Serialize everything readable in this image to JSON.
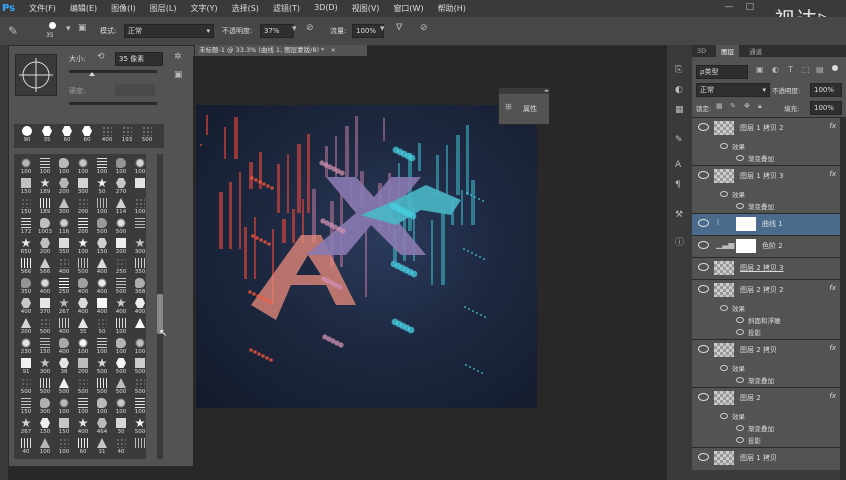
{
  "app": {
    "logo": "Ps",
    "watermark": "视达▷"
  },
  "menu": [
    "文件(F)",
    "编辑(E)",
    "图像(I)",
    "图层(L)",
    "文字(Y)",
    "选择(S)",
    "滤镜(T)",
    "3D(D)",
    "视图(V)",
    "窗口(W)",
    "帮助(H)"
  ],
  "window_controls": [
    "—",
    "□"
  ],
  "options_bar": {
    "brush_size": "35",
    "mode_label": "模式:",
    "mode_value": "正常",
    "opacity_label": "不透明度:",
    "opacity_value": "37%",
    "flow_label": "流量:",
    "flow_value": "100%"
  },
  "brush_panel": {
    "size_label": "大小:",
    "size_value": "35 像素",
    "hardness_label": "硬度:",
    "top_row": [
      "90",
      "35",
      "60",
      "60",
      "400",
      "193",
      "500"
    ],
    "grid_numbers": [
      [
        "100",
        "100",
        "100",
        "100",
        "100",
        "100",
        "100"
      ],
      [
        "150",
        "189",
        "200",
        "300",
        "50",
        "270",
        ""
      ],
      [
        "150",
        "189",
        "300",
        "200",
        "100",
        "114",
        "100"
      ],
      [
        "172",
        "1003",
        "116",
        "200",
        "500",
        "500",
        ""
      ],
      [
        "650",
        "200",
        "350",
        "100",
        "150",
        "200",
        "300"
      ],
      [
        "566",
        "566",
        "400",
        "500",
        "400",
        "250",
        "350"
      ],
      [
        "350",
        "400",
        "250",
        "400",
        "400",
        "500",
        "368"
      ],
      [
        "400",
        "370",
        "267",
        "400",
        "400",
        "400",
        "400"
      ],
      [
        "200",
        "500",
        "400",
        "35",
        "50",
        "100",
        ""
      ],
      [
        "230",
        "150",
        "400",
        "100",
        "100",
        "100",
        "100"
      ],
      [
        "91",
        "300",
        "38",
        "200",
        "500",
        "500",
        "500"
      ],
      [
        "500",
        "500",
        "500",
        "500",
        "500",
        "500",
        "500"
      ],
      [
        "150",
        "300",
        "100",
        "100",
        "100",
        "100",
        "100"
      ],
      [
        "267",
        "150",
        "150",
        "400",
        "464",
        "30",
        "500"
      ],
      [
        "40",
        "100",
        "100",
        "60",
        "31",
        "40",
        ""
      ]
    ]
  },
  "document": {
    "tab_title": "未标题-1 @ 33.3% (曲线 1, 图层蒙版/8) *",
    "close": "×"
  },
  "properties_panel": {
    "label": "属性"
  },
  "layers_panel": {
    "tabs": [
      "3D",
      "图层",
      "通道"
    ],
    "kind_filter": "ρ类型",
    "blend_mode": "正常",
    "opacity_label": "不透明度:",
    "opacity_value": "100%",
    "lock_label": "锁定:",
    "fill_label": "填充:",
    "fill_value": "100%",
    "layers": [
      {
        "name": "图层 1 拷贝 2",
        "fx": "fx",
        "effects_label": "效果",
        "effects": [
          "渐变叠加"
        ]
      },
      {
        "name": "图层 1 拷贝 3",
        "fx": "fx",
        "effects_label": "效果",
        "effects": [
          "渐变叠加"
        ]
      },
      {
        "name": "曲线 1",
        "fx": "",
        "effects_label": "",
        "effects": []
      },
      {
        "name": "色阶 2",
        "fx": "",
        "effects_label": "",
        "effects": []
      },
      {
        "name": "图层 2 拷贝 3",
        "fx": "",
        "effects_label": "",
        "effects": []
      },
      {
        "name": "图层 2 拷贝 2",
        "fx": "fx",
        "effects_label": "效果",
        "effects": [
          "斜面和浮雕",
          "投影"
        ]
      },
      {
        "name": "图层 2 拷贝",
        "fx": "fx",
        "effects_label": "效果",
        "effects": [
          "渐变叠加"
        ]
      },
      {
        "name": "图层 2",
        "fx": "fx",
        "effects_label": "效果",
        "effects": [
          "渐变叠加",
          "投影"
        ]
      },
      {
        "name": "图层 1 拷贝",
        "fx": "",
        "effects_label": "",
        "effects": []
      }
    ]
  },
  "colors": {
    "selected_layer": "#4a6b8c",
    "panel_bg": "#535353",
    "accent": "#31a8ff"
  }
}
